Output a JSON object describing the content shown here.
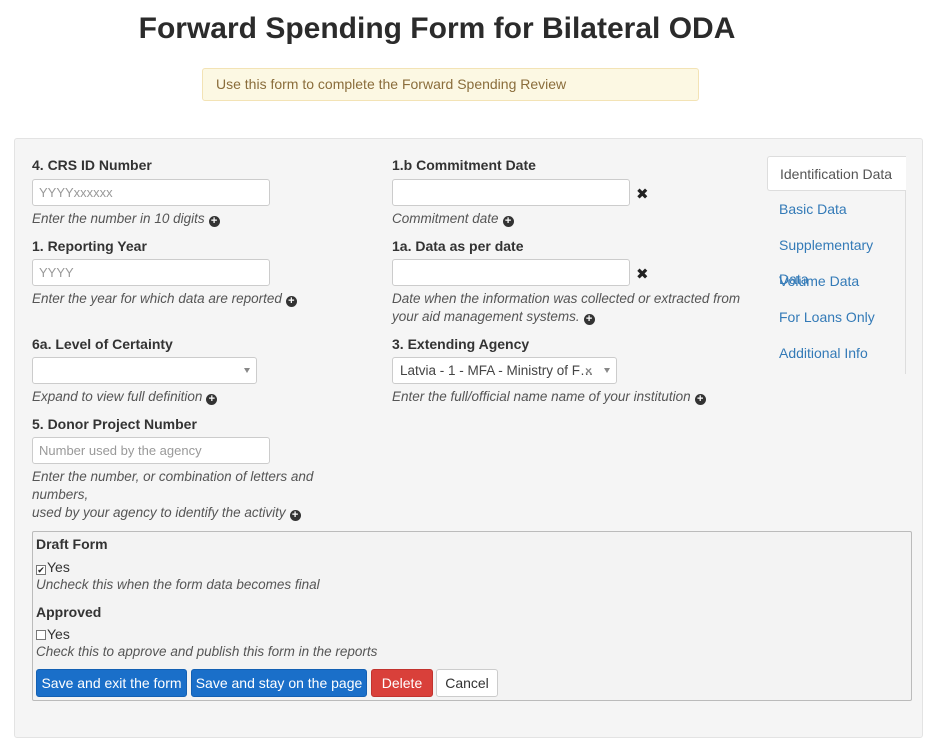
{
  "page": {
    "title": "Forward Spending Form for Bilateral ODA",
    "notice": "Use this form to complete the Forward Spending Review"
  },
  "fields": {
    "crs_id": {
      "label": "4. CRS ID Number",
      "placeholder": "YYYYxxxxxx",
      "value": "",
      "help": "Enter the number in 10 digits"
    },
    "commitment_date": {
      "label": "1.b Commitment Date",
      "value": "",
      "help": "Commitment date"
    },
    "reporting_year": {
      "label": "1. Reporting Year",
      "placeholder": "YYYY",
      "value": "",
      "help": "Enter the year for which data are reported"
    },
    "data_as_per_date": {
      "label": "1a. Data as per date",
      "value": "",
      "help_line1": "Date when the information was collected or extracted from",
      "help_line2": "your aid management systems."
    },
    "level_of_certainty": {
      "label": "6a. Level of Certainty",
      "value": "",
      "help": "Expand to view full definition"
    },
    "extending_agency": {
      "label": "3. Extending Agency",
      "value": "Latvia - 1 - MFA - Ministry of F…",
      "help": "Enter the full/official name name of your institution"
    },
    "donor_project_number": {
      "label": "5. Donor Project Number",
      "placeholder": "Number used by the agency",
      "value": "",
      "help_line1": "Enter the number, or combination of letters and numbers,",
      "help_line2": "used by your agency to identify the activity"
    }
  },
  "icons": {
    "plus": "+",
    "clear": "✖",
    "select_clear": "×",
    "check": "✔"
  },
  "tabs": [
    {
      "label": "Identification Data",
      "active": true
    },
    {
      "label": "Basic Data"
    },
    {
      "label": "Supplementary Data"
    },
    {
      "label": "Volume Data"
    },
    {
      "label": "For Loans Only"
    },
    {
      "label": "Additional Info"
    }
  ],
  "approval": {
    "draft": {
      "label": "Draft Form",
      "checkbox_label": "Yes",
      "checked": true,
      "help": "Uncheck this when the form data becomes final"
    },
    "approved": {
      "label": "Approved",
      "checkbox_label": "Yes",
      "checked": false,
      "help": "Check this to approve and publish this form in the reports"
    }
  },
  "buttons": {
    "save_exit": "Save and exit the form",
    "save_stay": "Save and stay on the page",
    "delete": "Delete",
    "cancel": "Cancel"
  }
}
